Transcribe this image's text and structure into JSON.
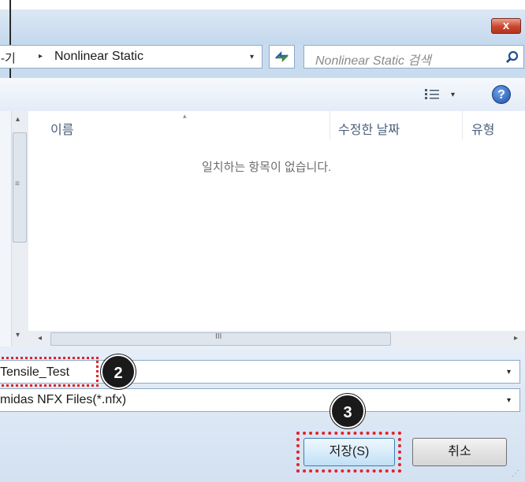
{
  "window": {
    "close_glyph": "x"
  },
  "address": {
    "prev_crumb": "-기",
    "separator": "▸",
    "current": "Nonlinear Static",
    "dropdown": "▾"
  },
  "search": {
    "placeholder": "Nonlinear Static 검색",
    "icon": "search-icon"
  },
  "toolbar": {
    "view_icon": "view-list-icon",
    "view_drop": "▾",
    "help_glyph": "?"
  },
  "list": {
    "columns": [
      "이름",
      "수정한 날짜",
      "유형"
    ],
    "sort_arrow": "▴",
    "empty_message": "일치하는 항목이 없습니다."
  },
  "scrollbar": {
    "up": "▴",
    "down": "▾",
    "left": "◂",
    "right": "▸",
    "vgrip": "≡",
    "hgrip": "III"
  },
  "form": {
    "filename": "Tensile_Test",
    "filetype": "midas NFX Files(*.nfx)",
    "drop": "▾",
    "save_label": "저장(S)",
    "cancel_label": "취소"
  },
  "annotations": {
    "badge_2": "2",
    "badge_3": "3",
    "highlight_color": "#e0242a"
  }
}
